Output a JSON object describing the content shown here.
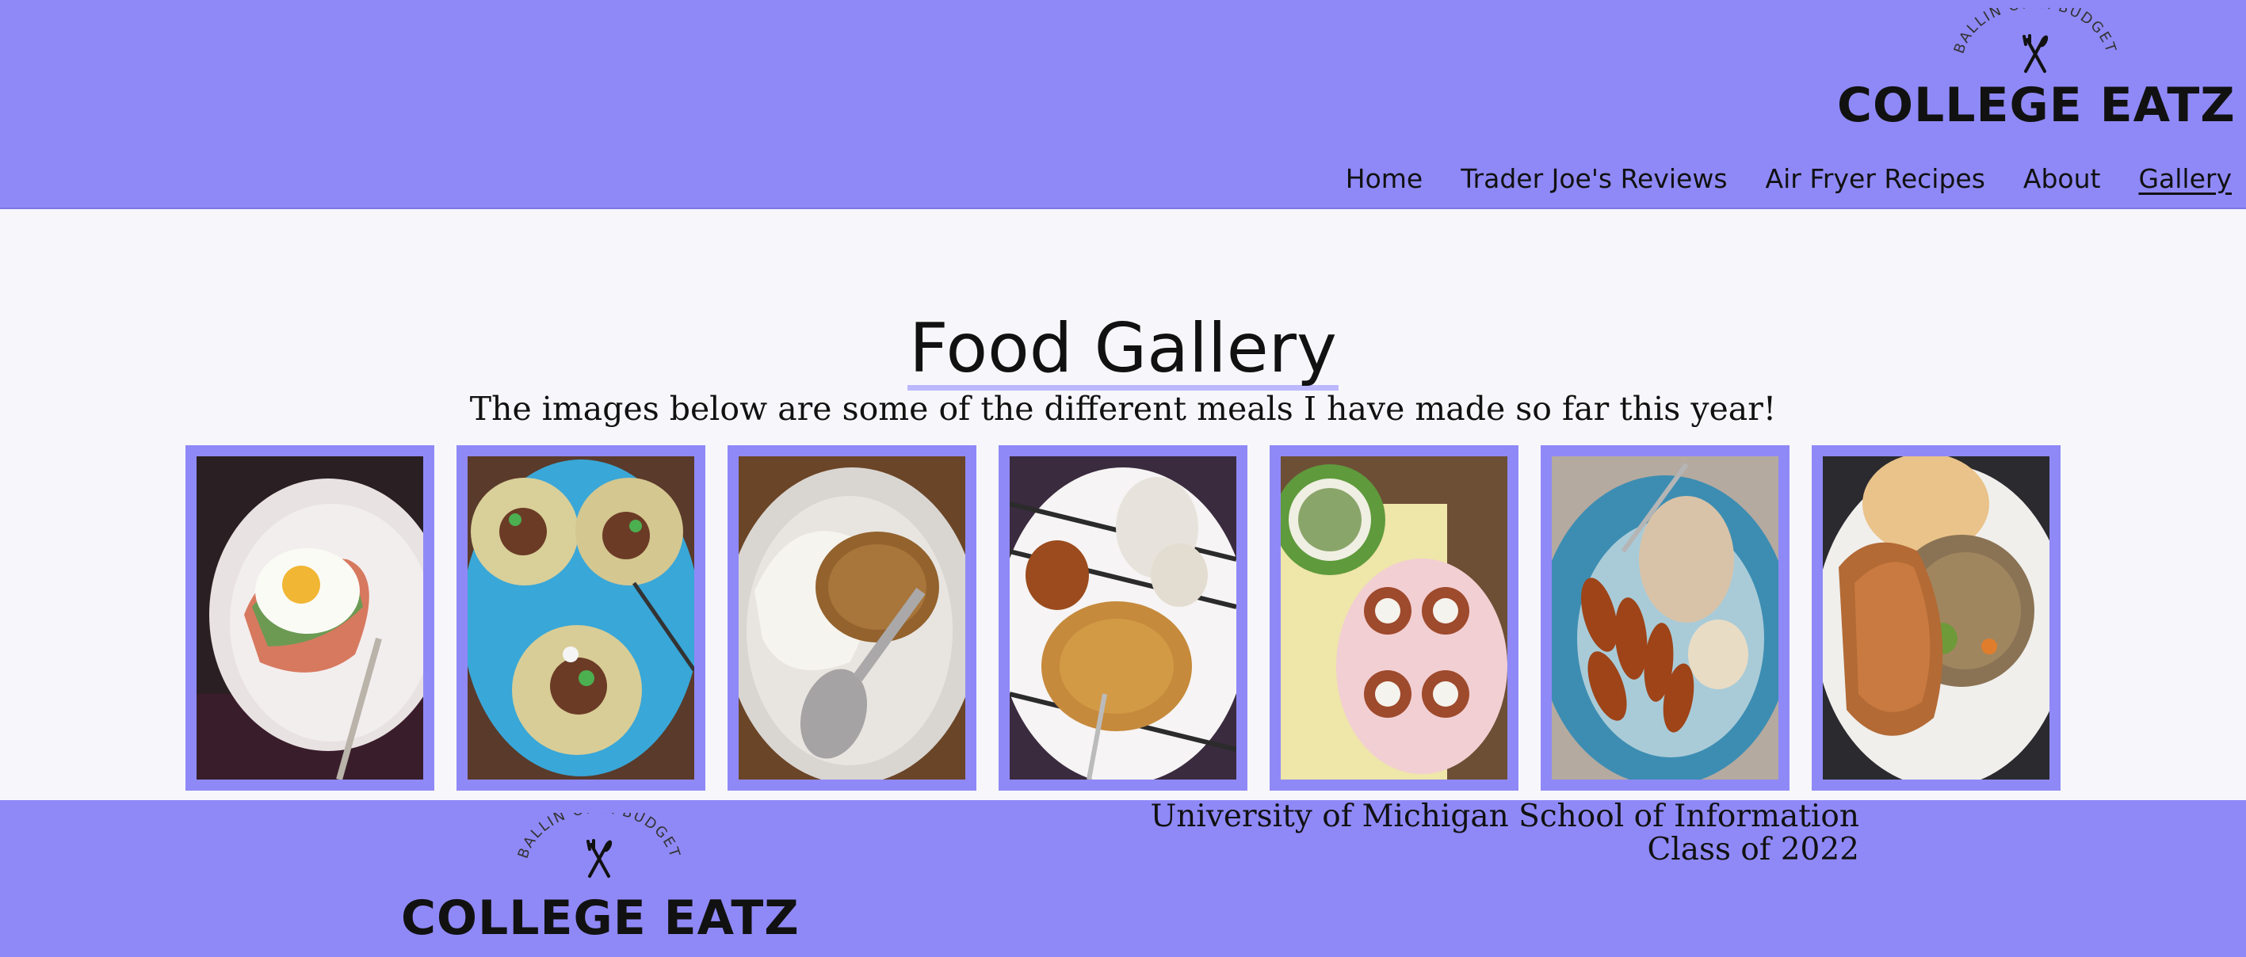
{
  "brand": {
    "tagline": "BALLIN ON A BUDGET",
    "name": "COLLEGE EATZ",
    "icon": "fork-knife-icon",
    "accent_color": "#8f89f7"
  },
  "nav": {
    "items": [
      {
        "label": "Home",
        "active": false
      },
      {
        "label": "Trader Joe's Reviews",
        "active": false
      },
      {
        "label": "Air Fryer Recipes",
        "active": false
      },
      {
        "label": "About",
        "active": false
      },
      {
        "label": "Gallery",
        "active": true
      }
    ]
  },
  "main": {
    "title": "Food Gallery",
    "subtitle": "The images below are some of the different meals I have made so far this year!"
  },
  "gallery": {
    "images": [
      {
        "icon": "egg-toast-photo"
      },
      {
        "icon": "tacos-photo"
      },
      {
        "icon": "yogurt-granola-photo"
      },
      {
        "icon": "noodles-dumplings-photo"
      },
      {
        "icon": "salad-bruschetta-photo"
      },
      {
        "icon": "chicken-tenders-photo"
      },
      {
        "icon": "salmon-rice-photo"
      }
    ]
  },
  "footer": {
    "school": "University of Michigan School of Information",
    "class_of": "Class of 2022"
  }
}
